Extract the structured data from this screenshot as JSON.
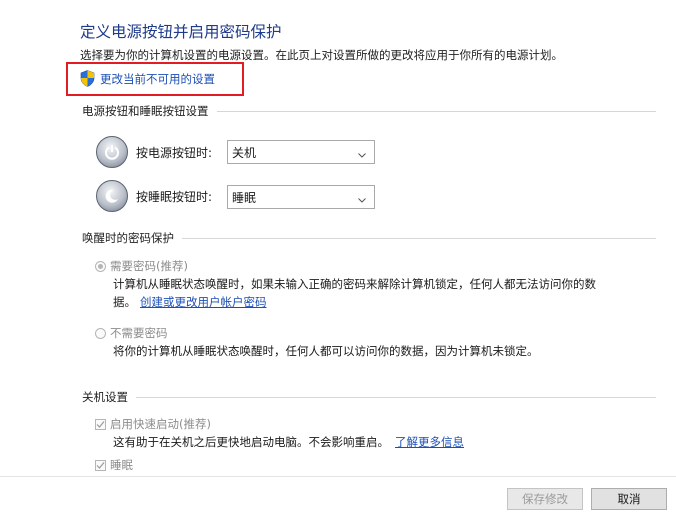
{
  "title": "定义电源按钮并启用密码保护",
  "subtitle": "选择要为你的计算机设置的电源设置。在此页上对设置所做的更改将应用于你所有的电源计划。",
  "change_unavailable_link": "更改当前不可用的设置",
  "power_section": {
    "heading": "电源按钮和睡眠按钮设置",
    "rows": [
      {
        "label": "按电源按钮时:",
        "value": "关机",
        "icon": "power-icon"
      },
      {
        "label": "按睡眠按钮时:",
        "value": "睡眠",
        "icon": "sleep-icon"
      }
    ]
  },
  "password_section": {
    "heading": "唤醒时的密码保护",
    "require_label": "需要密码(推荐)",
    "require_desc_1": "计算机从睡眠状态唤醒时，如果未输入正确的密码来解除计算机锁定，任何人都无法访问你的数",
    "require_desc_2": "据。",
    "require_link": "创建或更改用户帐户密码",
    "no_require_label": "不需要密码",
    "no_require_desc": "将你的计算机从睡眠状态唤醒时，任何人都可以访问你的数据，因为计算机未锁定。"
  },
  "shutdown_section": {
    "heading": "关机设置",
    "fast_startup_label": "启用快速启动(推荐)",
    "fast_startup_desc": "这有助于在关机之后更快地启动电脑。不会影响重启。",
    "fast_startup_link": "了解更多信息",
    "sleep_label": "睡眠"
  },
  "buttons": {
    "save": "保存修改",
    "cancel": "取消"
  },
  "colors": {
    "title": "#1e3a8a",
    "link": "#1c4fb5",
    "highlight_box": "#e31b23"
  }
}
